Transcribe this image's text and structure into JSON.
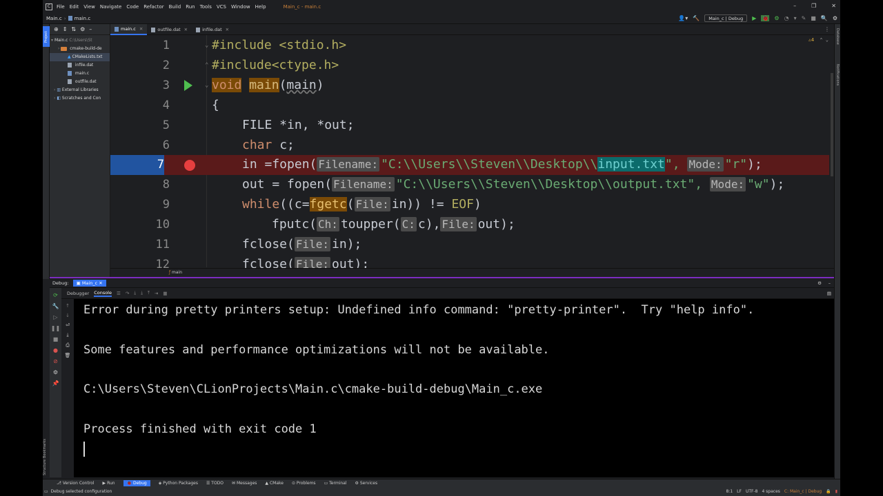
{
  "menu": {
    "items": [
      "File",
      "Edit",
      "View",
      "Navigate",
      "Code",
      "Refactor",
      "Build",
      "Run",
      "Tools",
      "VCS",
      "Window",
      "Help"
    ],
    "window_title": "Main_c - main.c"
  },
  "nav": {
    "project": "Main.c",
    "file": "main.c",
    "run_config": "Main_c | Debug"
  },
  "project_tree": {
    "root": "Main.c",
    "root_path": "C:\\Users\\St",
    "items": [
      "cmake-build-de",
      "CMakeLists.txt",
      "infile.dat",
      "main.c",
      "outfile.dat"
    ],
    "external": "External Libraries",
    "scratches": "Scratches and Con"
  },
  "editor": {
    "tabs": [
      "main.c",
      "outfile.dat",
      "infile.dat"
    ],
    "inspection_count": "4",
    "line_numbers": [
      "1",
      "2",
      "3",
      "4",
      "5",
      "6",
      "7",
      "8",
      "9",
      "10",
      "11",
      "12"
    ],
    "breadcrumb": "main",
    "hints": {
      "filename": "Filename:",
      "mode": "Mode:",
      "file": "File:",
      "ch": "Ch:",
      "c": "C:"
    },
    "code": {
      "l1": "#include <stdio.h>",
      "l2": "#include<ctype.h>",
      "l3_void": "void",
      "l3_main": "main",
      "l3_arg": "main",
      "l4": "{",
      "l5": "FILE *in, *out;",
      "l6_kw": "char",
      "l6_rest": " c;",
      "l7_pre": "in =fopen(",
      "l7_path": "\"C:\\\\Users\\\\Steven\\\\Desktop\\\\",
      "l7_file": "input.txt",
      "l7_q": "\",",
      "l7_mode": "\"r\"",
      "l7_end": ");",
      "l8_pre": "out = fopen(",
      "l8_path": "\"C:\\\\Users\\\\Steven\\\\Desktop\\\\output.txt\",",
      "l8_mode": "\"w\"",
      "l8_end": ");",
      "l9_kw": "while",
      "l9_a": "((c=",
      "l9_fn": "fgetc",
      "l9_b": "(",
      "l9_c": "in)) != ",
      "l9_eof": "EOF",
      "l9_d": ")",
      "l10_a": "fputc(",
      "l10_b": "toupper(",
      "l10_c": "c),",
      "l10_d": "out);",
      "l11_a": "fclose(",
      "l11_b": "in);",
      "l12_a": "fclose(",
      "l12_b": "out);"
    }
  },
  "debug": {
    "label": "Debug:",
    "config_tab": "Main_c",
    "tabs": [
      "Debugger",
      "Console"
    ]
  },
  "console": {
    "lines": [
      "Error during pretty printers setup: Undefined info command: \"pretty-printer\".  Try \"help info\".",
      "",
      "Some features and performance optimizations will not be available.",
      "",
      "C:\\Users\\Steven\\CLionProjects\\Main.c\\cmake-build-debug\\Main_c.exe",
      "",
      "Process finished with exit code 1"
    ]
  },
  "bottom_tabs": [
    "Version Control",
    "Run",
    "Debug",
    "Python Packages",
    "TODO",
    "Messages",
    "CMake",
    "Problems",
    "Terminal",
    "Services"
  ],
  "status": {
    "message": "Debug selected configuration",
    "position": "8:1",
    "line_sep": "LF",
    "encoding": "UTF-8",
    "indent": "4 spaces",
    "context": "C: Main_c | Debug"
  },
  "side_labels": {
    "project": "Project",
    "database": "Database",
    "notifications": "Notifications",
    "bookmarks": "Bookmarks",
    "structure": "Structure"
  },
  "colors": {
    "breakpoint_line": "#5a1a1a",
    "accent": "#3574f0",
    "debug_bar": "#7b2cbf"
  }
}
